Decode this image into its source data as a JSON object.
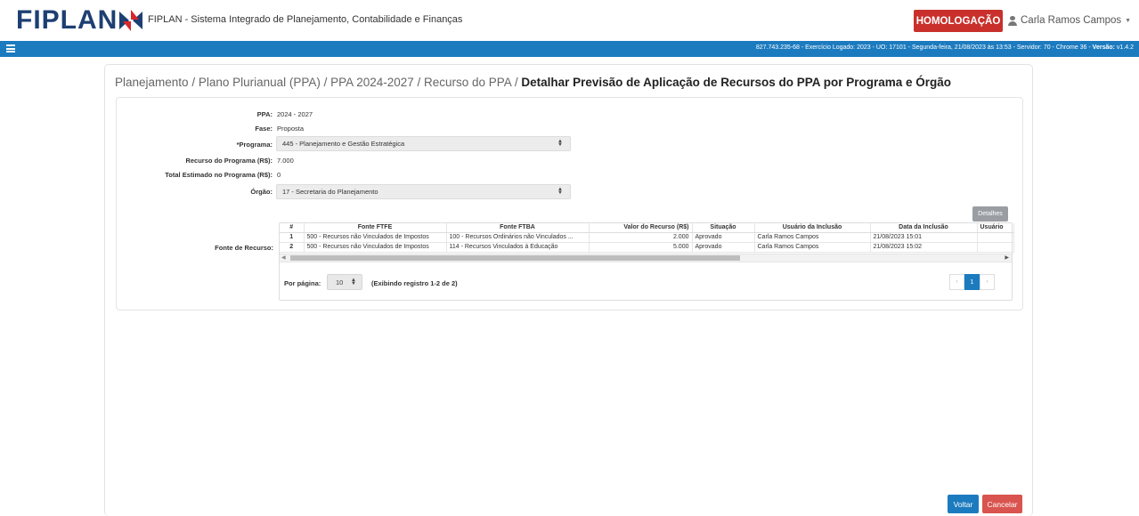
{
  "header": {
    "logo_text": "FIPLAN",
    "app_title": "FIPLAN - Sistema Integrado de Planejamento, Contabilidade e Finanças",
    "environment_badge": "HOMOLOGAÇÃO",
    "user_name": "Carla Ramos Campos"
  },
  "infobar": {
    "session_info": "827.743.235-68 - Exercício Logado: 2023 - UO: 17101 - Segunda-feira, 21/08/2023 às 13:53 - Servidor: 70 - Chrome 36 - ",
    "version_label": "Versão: ",
    "version_value": "v1.4.2"
  },
  "breadcrumb": {
    "items": [
      "Planejamento",
      "Plano Plurianual (PPA)",
      "PPA 2024-2027",
      "Recurso do PPA"
    ],
    "separator": " / ",
    "current": "Detalhar Previsão de Aplicação de Recursos do PPA por Programa e Órgão"
  },
  "form": {
    "ppa_label": "PPA:",
    "ppa_value": "2024 - 2027",
    "fase_label": "Fase:",
    "fase_value": "Proposta",
    "programa_label": "*Programa:",
    "programa_value": "445 - Planejamento e Gestão Estratégica",
    "recurso_programa_label": "Recurso do Programa (R$):",
    "recurso_programa_value": "7.000",
    "total_estimado_label": "Total Estimado no Programa (R$):",
    "total_estimado_value": "0",
    "orgao_label": "Órgão:",
    "orgao_value": "17 - Secretaria do Planejamento",
    "fonte_recurso_label": "Fonte de Recurso:"
  },
  "table": {
    "details_button": "Detalhes",
    "columns": [
      "#",
      "Fonte FTFE",
      "Fonte FTBA",
      "Valor do Recurso (R$)",
      "Situação",
      "Usuário da Inclusão",
      "Data da Inclusão",
      "Usuário"
    ],
    "rows": [
      [
        "1",
        "500 - Recursos não Vinculados de Impostos",
        "100 - Recursos Ordinários não Vinculados ...",
        "2.000",
        "Aprovado",
        "Carla Ramos Campos",
        "21/08/2023 15:01",
        ""
      ],
      [
        "2",
        "500 - Recursos não Vinculados de Impostos",
        "114 - Recursos Vinculados à Educação",
        "5.000",
        "Aprovado",
        "Carla Ramos Campos",
        "21/08/2023 15:02",
        ""
      ]
    ],
    "per_page_label": "Por página:",
    "per_page_value": "10",
    "records_info": "(Exibindo registro 1-2 de 2)",
    "pagination": {
      "prev": "‹",
      "current": "1",
      "next": "›"
    }
  },
  "footer": {
    "back_button": "Voltar",
    "cancel_button": "Cancelar"
  },
  "colors": {
    "brand_blue": "#1c7bbf",
    "logo_navy": "#1d3f72",
    "danger_red": "#c9302c"
  }
}
